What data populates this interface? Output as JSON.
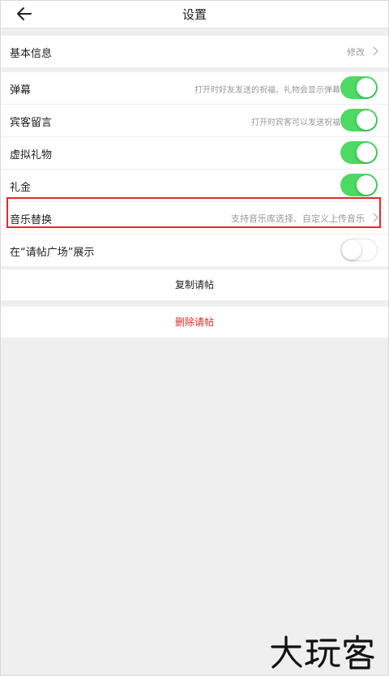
{
  "header": {
    "title": "设置",
    "back_icon": "arrow-left-icon"
  },
  "basic": {
    "label": "基本信息",
    "action": "修改"
  },
  "settings": [
    {
      "label": "弹幕",
      "desc": "打开时好友发送的祝福、礼物会显示弹幕",
      "toggle": true
    },
    {
      "label": "宾客留言",
      "desc": "打开时宾客可以发送祝福",
      "toggle": true
    },
    {
      "label": "虚拟礼物",
      "desc": "",
      "toggle": true
    },
    {
      "label": "礼金",
      "desc": "",
      "toggle": true
    },
    {
      "label": "音乐替换",
      "desc": "支持音乐库选择、自定义上传音乐"
    },
    {
      "label": "在“请帖广场”展示",
      "desc": "",
      "toggle": false
    }
  ],
  "actions": {
    "copy": "复制请帖",
    "delete": "删除请帖"
  },
  "watermark": "大玩客",
  "colors": {
    "toggle_on": "#4cd964",
    "delete": "#e8262b",
    "highlight": "#e8262b"
  }
}
